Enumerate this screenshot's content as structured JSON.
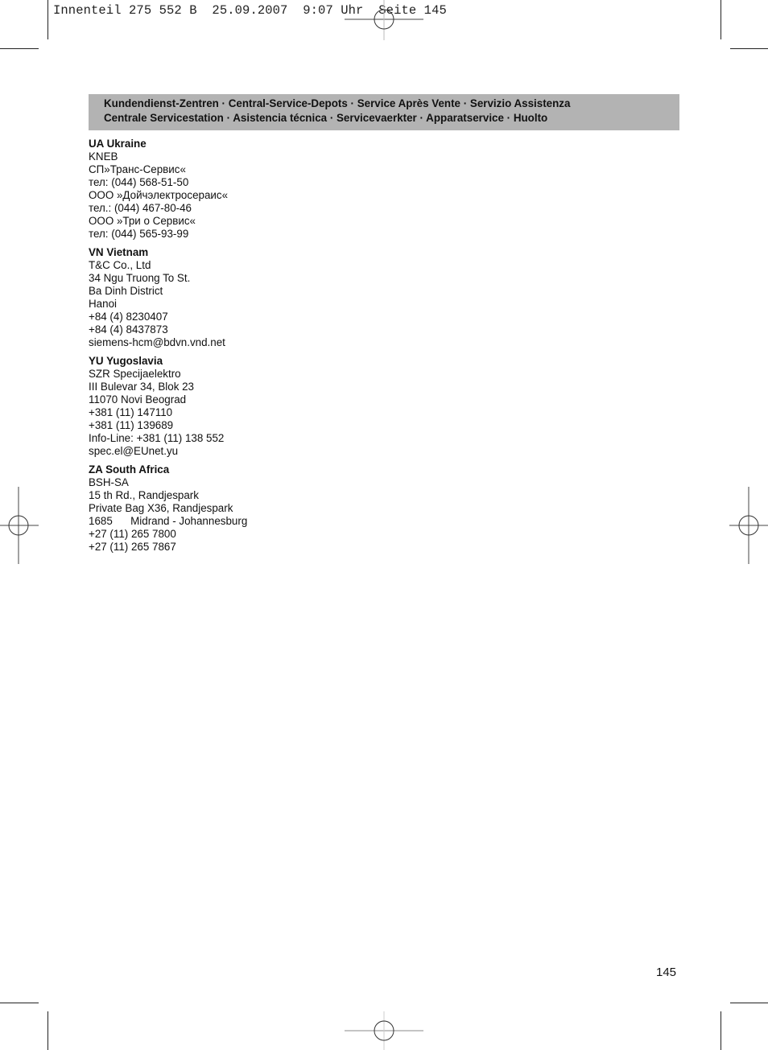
{
  "slug": "Innenteil 275 552 B  25.09.2007  9:07 Uhr  Seite 145",
  "banner": {
    "line1": "Kundendienst-Zentren · Central-Service-Depots · Service Après Vente · Servizio Assistenza",
    "line2": "Centrale Servicestation · Asistencia técnica · Servicevaerkter · Apparatservice · Huolto"
  },
  "sections": [
    {
      "title": "UA Ukraine",
      "lines": [
        "KNEB",
        "СП»Транс-Сервис«",
        "тел: (044) 568-51-50",
        "ООО »Дойчэлектросераис«",
        "тел.: (044) 467-80-46",
        "ООО »Три о Сервис«",
        "тел: (044) 565-93-99"
      ]
    },
    {
      "title": "VN Vietnam",
      "lines": [
        "T&C Co., Ltd",
        "34 Ngu Truong To St.",
        "Ba Dinh District",
        "Hanoi",
        "+84 (4) 8230407",
        "+84 (4) 8437873",
        "siemens-hcm@bdvn.vnd.net"
      ]
    },
    {
      "title": "YU Yugoslavia",
      "lines": [
        "SZR Specijaelektro",
        "III Bulevar 34, Blok 23",
        "11070 Novi Beograd",
        "+381 (11) 147110",
        "+381 (11) 139689",
        "Info-Line: +381 (11) 138 552",
        "spec.el@EUnet.yu"
      ]
    },
    {
      "title": "ZA South Africa",
      "lines": [
        "BSH-SA",
        "15 th Rd., Randjespark",
        "Private Bag X36, Randjespark",
        "1685      Midrand - Johannesburg",
        "+27 (11) 265 7800",
        "+27 (11) 265 7867"
      ]
    }
  ],
  "page_number": "145"
}
